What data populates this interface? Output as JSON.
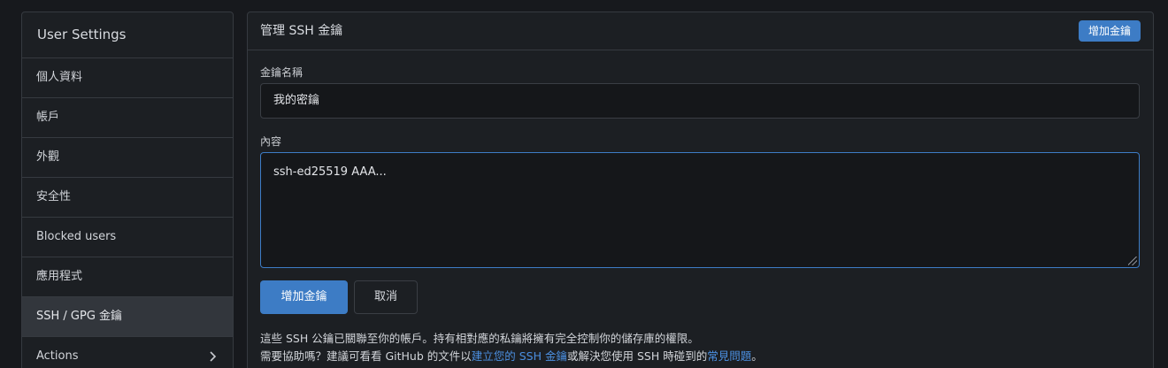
{
  "sidebar": {
    "title": "User Settings",
    "items": [
      {
        "label": "個人資料"
      },
      {
        "label": "帳戶"
      },
      {
        "label": "外觀"
      },
      {
        "label": "安全性"
      },
      {
        "label": "Blocked users"
      },
      {
        "label": "應用程式"
      },
      {
        "label": "SSH / GPG 金鑰",
        "active": true
      },
      {
        "label": "Actions",
        "icon": "chevron-right-icon"
      }
    ]
  },
  "panel": {
    "title": "管理 SSH 金鑰",
    "add_key_label": "增加金鑰"
  },
  "form": {
    "name_label": "金鑰名稱",
    "name_value": "我的密鑰",
    "content_label": "內容",
    "content_value": "ssh-ed25519 AAA...",
    "submit_label": "增加金鑰",
    "cancel_label": "取消"
  },
  "help": {
    "line1": "這些 SSH 公鑰已關聯至你的帳戶。持有相對應的私鑰將擁有完全控制你的儲存庫的權限。",
    "line2_prefix": "需要協助嗎？建議可看看 GitHub 的文件以",
    "line2_link1": "建立您的 SSH 金鑰",
    "line2_middle": "或解決您使用 SSH 時碰到的",
    "line2_link2": "常見問題",
    "line2_suffix": "。"
  },
  "colors": {
    "accent": "#3d7cc5",
    "link": "#4b8fe0",
    "background": "#17191d"
  }
}
